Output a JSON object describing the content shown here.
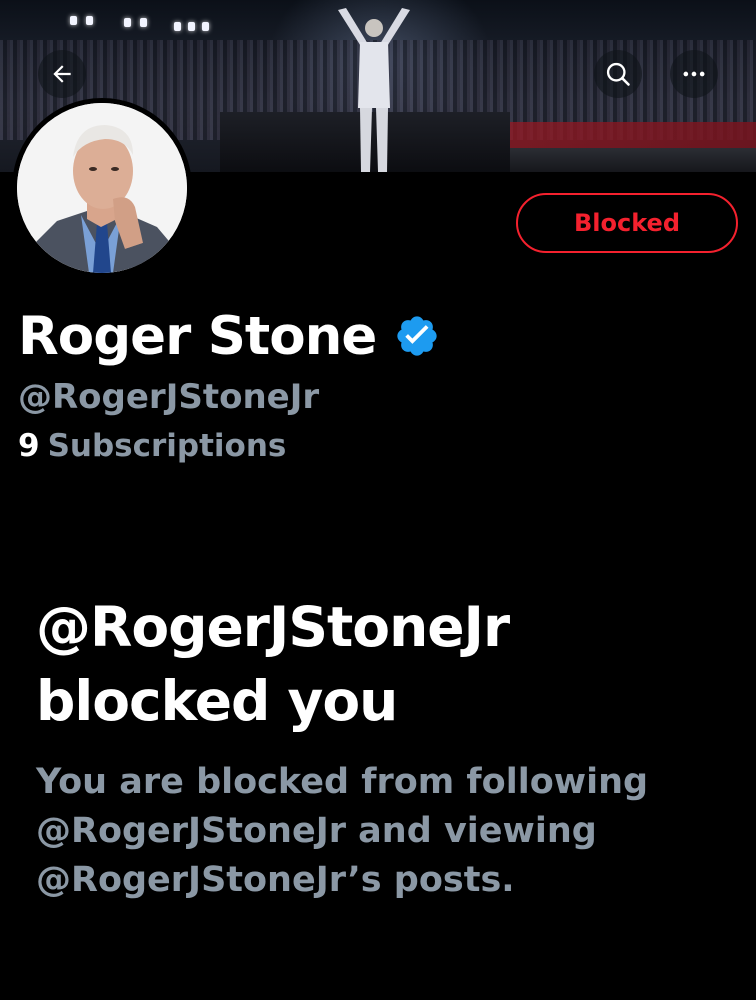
{
  "header": {
    "back_icon": "arrow-left-icon",
    "search_icon": "search-icon",
    "more_icon": "more-horizontal-icon"
  },
  "profile": {
    "name": "Roger Stone",
    "verified_icon": "verified-badge-icon",
    "handle": "@RogerJStoneJr",
    "subscriptions_count": "9",
    "subscriptions_label": "Subscriptions",
    "blocked_button_label": "Blocked"
  },
  "blocked_notice": {
    "title_line1": "@RogerJStoneJr",
    "title_line2": "blocked you",
    "desc_line1": "You are blocked from following",
    "desc_line2": "@RogerJStoneJr and viewing",
    "desc_line3": "@RogerJStoneJr’s posts."
  },
  "colors": {
    "background": "#000000",
    "primary_text": "#ffffff",
    "secondary_text": "#8b98a5",
    "blocked_red": "#f4212e",
    "verified_blue": "#1d9bf0"
  }
}
